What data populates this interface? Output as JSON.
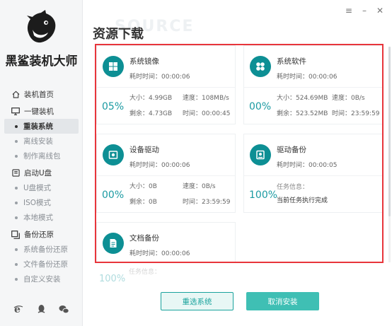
{
  "app": {
    "name": "黑鲨装机大师"
  },
  "window_controls": {
    "menu": "≡",
    "minimize": "–",
    "close": "✕"
  },
  "sidebar": {
    "groups": [
      {
        "label": "装机首页",
        "icon": "home-icon",
        "items": []
      },
      {
        "label": "一键装机",
        "icon": "monitor-icon",
        "items": [
          "重装系统",
          "离线安装",
          "制作离线包"
        ]
      },
      {
        "label": "启动U盘",
        "icon": "usb-icon",
        "items": [
          "U盘模式",
          "ISO模式",
          "本地模式"
        ]
      },
      {
        "label": "备份还原",
        "icon": "backup-icon",
        "items": [
          "系统备份还原",
          "文件备份还原",
          "自定义安装"
        ]
      }
    ],
    "active_item": "重装系统",
    "bottom_icons": [
      "ie-icon",
      "qq-icon",
      "wechat-icon"
    ]
  },
  "page": {
    "title": "资源下载",
    "title_bg": "SOURCE"
  },
  "downloads": [
    {
      "name": "系统镜像",
      "icon": "windows-icon",
      "elapsed": "耗时时间：00:00:06",
      "percent": "05%",
      "size": "大小：4.99GB",
      "speed": "速度：108MB/s",
      "remaining": "剩余：4.73GB",
      "time": "时间：00:00:45"
    },
    {
      "name": "系统软件",
      "icon": "apps-icon",
      "elapsed": "耗时时间：00:00:06",
      "percent": "00%",
      "size": "大小：524.69MB",
      "speed": "速度：0B/s",
      "remaining": "剩余：523.52MB",
      "time": "时间：23:59:59"
    },
    {
      "name": "设备驱动",
      "icon": "driver-icon",
      "elapsed": "耗时时间：00:00:06",
      "percent": "00%",
      "size": "大小：0B",
      "speed": "速度：0B/s",
      "remaining": "剩余：0B",
      "time": "时间：23:59:59"
    },
    {
      "name": "驱动备份",
      "icon": "drive-backup-icon",
      "elapsed": "耗时时间：00:00:05",
      "percent": "100%",
      "info_label": "任务信息：",
      "info_value": "当前任务执行完成"
    },
    {
      "name": "文档备份",
      "icon": "document-icon",
      "elapsed": "耗时时间：00:00:06"
    }
  ],
  "ghost_row": {
    "percent": "100%",
    "info_label": "任务信息："
  },
  "buttons": {
    "reselect": "重选系统",
    "cancel": "取消安装"
  },
  "colors": {
    "accent": "#1aa39d",
    "icon_bg": "#0d8f94",
    "highlight_border": "#e8353b"
  }
}
